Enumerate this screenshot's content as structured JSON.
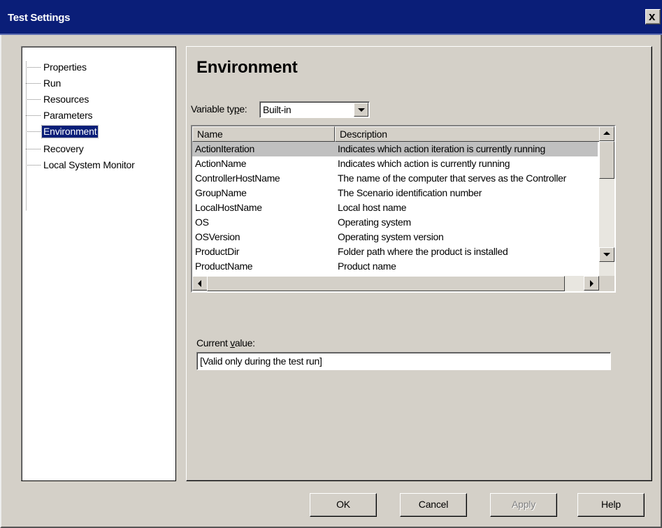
{
  "window": {
    "title": "Test Settings",
    "close_glyph": "x"
  },
  "tree": {
    "items": [
      {
        "label": "Properties"
      },
      {
        "label": "Run"
      },
      {
        "label": "Resources"
      },
      {
        "label": "Parameters"
      },
      {
        "label": "Environment",
        "selected": true
      },
      {
        "label": "Recovery"
      },
      {
        "label": "Local System Monitor"
      }
    ]
  },
  "panel": {
    "heading": "Environment",
    "variable_type": {
      "label_prefix": "Variable ty",
      "label_mnemonic": "p",
      "label_suffix": "e:",
      "value": "Built-in"
    },
    "list": {
      "columns": [
        "Name",
        "Description"
      ],
      "rows": [
        {
          "name": "ActionIteration",
          "description": "Indicates which action iteration is currently running",
          "selected": true
        },
        {
          "name": "ActionName",
          "description": "Indicates which action is currently running"
        },
        {
          "name": "ControllerHostName",
          "description": "The name of the computer that serves as the Controller"
        },
        {
          "name": "GroupName",
          "description": "The Scenario identification number"
        },
        {
          "name": "LocalHostName",
          "description": "Local host name"
        },
        {
          "name": "OS",
          "description": "Operating system"
        },
        {
          "name": "OSVersion",
          "description": "Operating system version"
        },
        {
          "name": "ProductDir",
          "description": "Folder path where the product is installed"
        },
        {
          "name": "ProductName",
          "description": "Product name"
        }
      ]
    },
    "current_value": {
      "label_prefix": "Current ",
      "label_mnemonic": "v",
      "label_suffix": "alue:",
      "value": "[Valid only during the test run]"
    }
  },
  "buttons": {
    "ok": "OK",
    "cancel": "Cancel",
    "apply": "Apply",
    "help": "Help"
  },
  "colors": {
    "titlebar": "#0a1e78",
    "face": "#d4d0c8",
    "selection": "#0a1e78"
  }
}
